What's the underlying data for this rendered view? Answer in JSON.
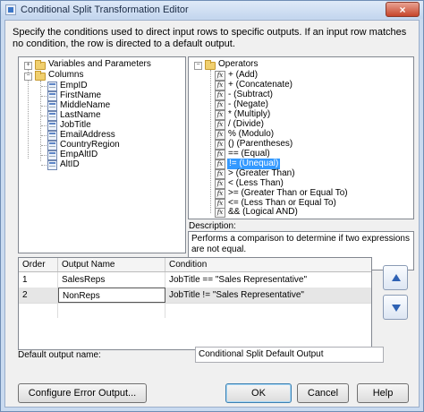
{
  "window": {
    "title": "Conditional Split Transformation Editor",
    "close_glyph": "×"
  },
  "instructions": "Specify the conditions used to direct input rows to specific outputs. If an input row matches no condition, the row is directed to a default output.",
  "columns_tree": {
    "variables_label": "Variables and Parameters",
    "columns_label": "Columns",
    "columns": [
      "EmpID",
      "FirstName",
      "MiddleName",
      "LastName",
      "JobTitle",
      "EmailAddress",
      "CountryRegion",
      "EmpAltID",
      "AltID"
    ]
  },
  "operators_tree": {
    "root_label": "Operators",
    "fx_glyph": "fx",
    "items": [
      "+ (Add)",
      "+ (Concatenate)",
      "- (Subtract)",
      "- (Negate)",
      "* (Multiply)",
      "/ (Divide)",
      "% (Modulo)",
      "() (Parentheses)",
      "== (Equal)",
      "!= (Unequal)",
      "> (Greater Than)",
      "< (Less Than)",
      ">= (Greater Than or Equal To)",
      "<= (Less Than or Equal To)",
      "&& (Logical AND)"
    ],
    "selected_index": 9
  },
  "description": {
    "label": "Description:",
    "text": "Performs a comparison to determine if two expressions are not equal."
  },
  "grid": {
    "headers": [
      "Order",
      "Output Name",
      "Condition"
    ],
    "rows": [
      {
        "order": "1",
        "name": "SalesReps",
        "condition": "JobTitle == \"Sales Representative\""
      },
      {
        "order": "2",
        "name": "NonReps",
        "condition": "JobTitle != \"Sales Representative\""
      }
    ]
  },
  "default_output": {
    "label": "Default output name:",
    "value": "Conditional Split Default Output"
  },
  "buttons": {
    "configure": "Configure Error Output...",
    "ok": "OK",
    "cancel": "Cancel",
    "help": "Help"
  },
  "colors": {
    "selection": "#3399ff",
    "move_arrow": "#2f62b4"
  }
}
